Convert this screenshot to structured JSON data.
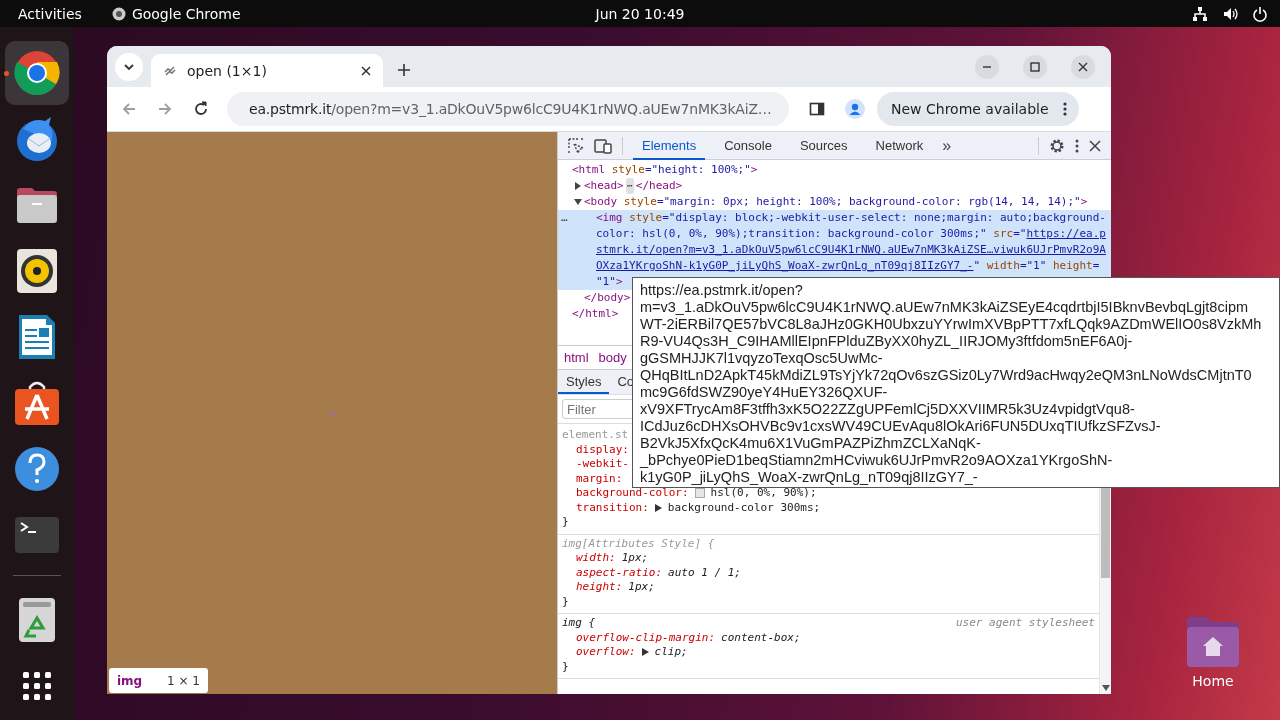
{
  "top_bar": {
    "activities": "Activities",
    "app_name": "Google Chrome",
    "clock": "Jun 20  10:49"
  },
  "dock": {
    "items": [
      {
        "kind": "chrome",
        "running": true
      },
      {
        "kind": "mail",
        "running": false
      },
      {
        "kind": "files",
        "running": false
      },
      {
        "kind": "speaker",
        "running": false
      },
      {
        "kind": "writer",
        "running": false
      },
      {
        "kind": "store",
        "running": false
      },
      {
        "kind": "help",
        "running": false
      },
      {
        "kind": "terminal",
        "running": false
      },
      {
        "kind": "separator"
      },
      {
        "kind": "trash",
        "running": false
      },
      {
        "kind": "apps",
        "running": false
      }
    ]
  },
  "desktop_icons": [
    {
      "label": "Home"
    }
  ],
  "browser": {
    "tabs": [
      {
        "title": "open (1×1)",
        "selected": true
      }
    ],
    "url_host": "ea.pstmrk.it",
    "url_rest": "/open?m=v3_1.aDkOuV5pw6lcC9U4K1rNWQ.aUEw7nMK3kAiZ…",
    "update_button": "New Chrome available",
    "page": {
      "badge_tag": "img",
      "badge_size": "1 × 1"
    },
    "devtools": {
      "tabs": [
        {
          "label": "Elements",
          "selected": true
        },
        {
          "label": "Console",
          "selected": false
        },
        {
          "label": "Sources",
          "selected": false
        },
        {
          "label": "Network",
          "selected": false
        }
      ],
      "more_tabs": "»",
      "dom": [
        {
          "open": [
            {
              "kind": "tag",
              "text": "<html "
            },
            {
              "kind": "attr",
              "text": "style"
            },
            {
              "kind": "value",
              "text": "=\"height: 100%;\""
            },
            {
              "kind": "tag",
              "text": ">"
            }
          ],
          "close": [
            {
              "kind": "tag",
              "text": "</html>"
            }
          ],
          "children": [
            {
              "expanded": false,
              "open": [
                {
                  "kind": "tag",
                  "text": "<head>"
                }
              ],
              "collapsed_mark": "⋯",
              "close": [
                {
                  "kind": "tag",
                  "text": "</head>"
                }
              ]
            },
            {
              "expanded": true,
              "open": [
                {
                  "kind": "tag",
                  "text": "<body "
                },
                {
                  "kind": "attr",
                  "text": "style"
                },
                {
                  "kind": "value",
                  "text": "=\"margin: 0px; height: 100%; background-color: rgb(14, 14, 14);\""
                },
                {
                  "kind": "tag",
                  "text": ">"
                }
              ],
              "close": [
                {
                  "kind": "tag",
                  "text": "</body>"
                }
              ],
              "children": [
                {
                  "selected": true,
                  "row_menu": "…",
                  "lines": [
                    [
                      {
                        "kind": "tag",
                        "text": "<img "
                      },
                      {
                        "kind": "attr",
                        "text": "style"
                      },
                      {
                        "kind": "value",
                        "text": "=\"display: block;-webkit-user-select: none;margin: auto;background-"
                      }
                    ],
                    [
                      {
                        "kind": "value",
                        "text": "color: hsl(0, 0%, 90%);transition: background-color 300ms;\" "
                      },
                      {
                        "kind": "attr",
                        "text": "src"
                      },
                      {
                        "kind": "value",
                        "text": "=\""
                      },
                      {
                        "kind": "link",
                        "text": "https://ea.p"
                      }
                    ],
                    [
                      {
                        "kind": "link",
                        "text": "stmrk.it/open?m=v3_1.aDkOuV5pw6lcC9U4K1rNWQ.aUEw7nMK3kAiZSE…viwuk6UJrPmvR2o9A"
                      }
                    ],
                    [
                      {
                        "kind": "link",
                        "text": "OXza1YKrgoShN-k1yG0P_jiLyQhS_WoaX-zwrQnLg_nT09qj8IIzGY7_-"
                      },
                      {
                        "kind": "value",
                        "text": "\" "
                      },
                      {
                        "kind": "attr",
                        "text": "width"
                      },
                      {
                        "kind": "value",
                        "text": "=\"1\" "
                      },
                      {
                        "kind": "attr",
                        "text": "height"
                      },
                      {
                        "kind": "value",
                        "text": "="
                      }
                    ],
                    [
                      {
                        "kind": "value",
                        "text": "\"1\""
                      },
                      {
                        "kind": "tag",
                        "text": ">"
                      }
                    ]
                  ]
                }
              ]
            }
          ]
        }
      ],
      "breadcrumbs": [
        "html",
        "body"
      ],
      "side_tabs": [
        {
          "label": "Styles",
          "selected": true
        },
        {
          "label": "Co",
          "selected": false
        }
      ],
      "filter_placeholder": "Filter",
      "rules": [
        {
          "kind": "inline",
          "selector": "element.st",
          "declarations": [
            {
              "name": "display:"
            },
            {
              "name": "-webkit-"
            },
            {
              "name": "margin:"
            },
            {
              "name": "background-color:",
              "color": "#e6e6e6",
              "value": "hsl(0, 0%, 90%);"
            },
            {
              "name": "transition:",
              "expander": true,
              "value": "background-color 300ms;"
            }
          ],
          "close": "}"
        },
        {
          "kind": "attributes",
          "selector": "img[Attributes Style]",
          "open": "{",
          "declarations": [
            {
              "name": "width:",
              "value": "1px;"
            },
            {
              "name": "aspect-ratio:",
              "value": "auto 1 / 1;"
            },
            {
              "name": "height:",
              "value": "1px;"
            }
          ],
          "close": "}"
        },
        {
          "kind": "user_agent",
          "selector": "img",
          "open": "{",
          "origin": "user agent stylesheet",
          "declarations": [
            {
              "name": "overflow-clip-margin:",
              "value": "content-box;"
            },
            {
              "name": "overflow:",
              "expander": true,
              "value": "clip;"
            }
          ],
          "close": "}"
        }
      ]
    },
    "tooltip": {
      "lines": [
        "https://ea.pstmrk.it/open?",
        "m=v3_1.aDkOuV5pw6lcC9U4K1rNWQ.aUEw7nMK3kAiZSEyE4cqdrtbjI5IBknvBevbqLgjt8cipm",
        "WT-2iERBil7QE57bVC8L8aJHz0GKH0UbxzuYYrwImXVBpPTT7xfLQqk9AZDmWElIO0s8VzkMh",
        "R9-VU4Qs3H_C9IHAMllEIpnFPlduZByXX0hyZL_IIRJOMy3ftfdom5nEF6A0j-",
        "gGSMHJJK7l1vqyzoTexqOsc5UwMc-",
        "QHqBItLnD2ApkT45kMdiZL9TsYjYk72qOv6szGSiz0Ly7Wrd9acHwqy2eQM3nLNoWdsCMjtnT0",
        "mc9G6fdSWZ90yeY4HuEY326QXUF-",
        "xV9XFTrycAm8F3tffh3xK5O22ZZgUPFemlCj5DXXVIIMR5k3Uz4vpidgtVqu8-",
        "ICdJuz6cDHXsOHVBc9v1cxsWV49CUEvAqu8lOkAri6FUN5DUxqTIUfkzSFZvsJ-",
        "B2VkJ5XfxQcK4mu6X1VuGmPAZPiZhmZCLXaNqK-",
        "_bPchye0PieD1beqStiamn2mHCviwuk6UJrPmvR2o9AOXza1YKrgoShN-",
        "k1yG0P_jiLyQhS_WoaX-zwrQnLg_nT09qj8IIzGY7_-"
      ]
    }
  }
}
